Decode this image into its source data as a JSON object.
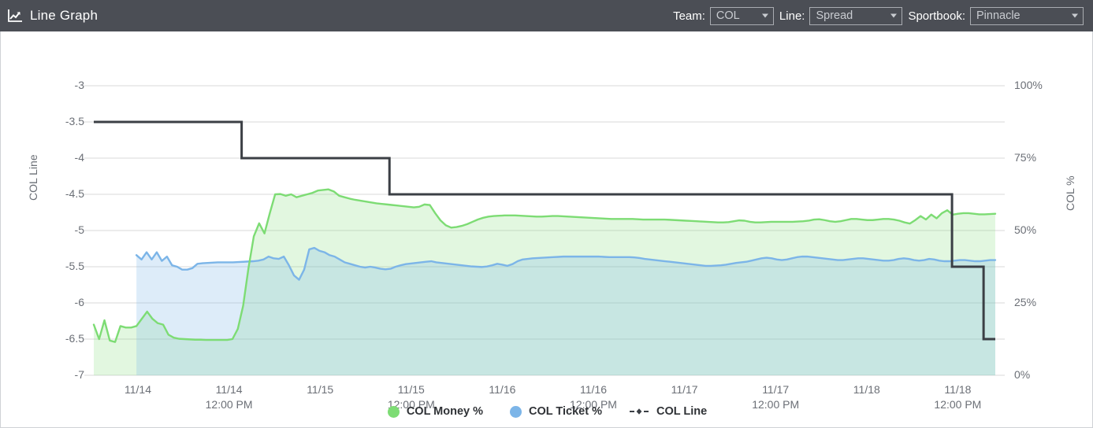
{
  "header": {
    "title": "Line Graph",
    "icon": "line-chart-icon",
    "controls": [
      {
        "label": "Team:",
        "value": "COL",
        "name": "team"
      },
      {
        "label": "Line:",
        "value": "Spread",
        "name": "line"
      },
      {
        "label": "Sportbook:",
        "value": "Pinnacle",
        "name": "sportbook"
      }
    ]
  },
  "colors": {
    "header_bg": "#4b4e55",
    "money_green": "#7ddc74",
    "ticket_blue": "#7cb5e8",
    "col_line_dark": "#3b3f45",
    "grid": "#ececec",
    "axis_text": "#6b6f76"
  },
  "legend": [
    {
      "label": "COL Money %",
      "marker": "circle",
      "color": "#7ddc74"
    },
    {
      "label": "COL Ticket %",
      "marker": "circle",
      "color": "#7cb5e8"
    },
    {
      "label": "COL Line",
      "marker": "dash-diamond",
      "color": "#3b3f45"
    }
  ],
  "chart_data": {
    "type": "line",
    "title": "Line Graph",
    "xlabel": "",
    "grid": true,
    "legend_position": "bottom",
    "axes": {
      "left": {
        "label": "COL Line",
        "ticks": [
          "-3",
          "-3.5",
          "-4",
          "-4.5",
          "-5",
          "-5.5",
          "-6",
          "-6.5",
          "-7"
        ],
        "min": -7,
        "max": -3
      },
      "right": {
        "label": "COL %",
        "ticks": [
          "100%",
          "75%",
          "50%",
          "25%",
          "0%"
        ],
        "min": 0,
        "max": 100
      }
    },
    "x_ticks": [
      {
        "date": "11/14",
        "time": ""
      },
      {
        "date": "11/14",
        "time": "12:00 PM"
      },
      {
        "date": "11/15",
        "time": ""
      },
      {
        "date": "11/15",
        "time": "12:00 PM"
      },
      {
        "date": "11/16",
        "time": ""
      },
      {
        "date": "11/16",
        "time": "12:00 PM"
      },
      {
        "date": "11/17",
        "time": ""
      },
      {
        "date": "11/17",
        "time": "12:00 PM"
      },
      {
        "date": "11/18",
        "time": ""
      },
      {
        "date": "11/18",
        "time": "12:00 PM"
      }
    ],
    "series": [
      {
        "name": "COL Money %",
        "axis": "right",
        "type": "area",
        "color": "#7ddc74",
        "values": [
          17.5,
          12.5,
          19.0,
          12.0,
          11.5,
          17.0,
          16.5,
          16.5,
          17.0,
          19.5,
          22.0,
          19.5,
          18.0,
          17.5,
          14.0,
          13.0,
          12.6,
          12.5,
          12.4,
          12.3,
          12.3,
          12.2,
          12.2,
          12.2,
          12.2,
          12.2,
          12.5,
          16.0,
          24.0,
          37.0,
          48.0,
          52.5,
          49.0,
          56.0,
          62.5,
          62.6,
          62.0,
          62.5,
          61.5,
          62.0,
          62.5,
          63.0,
          63.8,
          64.0,
          64.2,
          63.5,
          62.0,
          61.5,
          61.0,
          60.6,
          60.3,
          60.0,
          59.7,
          59.4,
          59.2,
          59.0,
          58.8,
          58.6,
          58.4,
          58.2,
          58.0,
          58.2,
          59.0,
          58.8,
          56.0,
          53.5,
          51.8,
          51.0,
          51.2,
          51.6,
          52.2,
          53.0,
          53.8,
          54.4,
          54.8,
          55.0,
          55.1,
          55.2,
          55.2,
          55.2,
          55.1,
          55.0,
          54.9,
          54.8,
          54.8,
          54.9,
          55.0,
          55.0,
          54.9,
          54.8,
          54.7,
          54.6,
          54.5,
          54.4,
          54.3,
          54.2,
          54.1,
          54.0,
          54.0,
          54.0,
          54.0,
          54.0,
          53.9,
          53.8,
          53.8,
          53.8,
          53.8,
          53.8,
          53.7,
          53.6,
          53.5,
          53.4,
          53.3,
          53.2,
          53.1,
          53.0,
          52.9,
          52.8,
          52.8,
          52.9,
          53.2,
          53.5,
          53.4,
          53.0,
          52.8,
          52.8,
          52.9,
          53.0,
          53.0,
          53.0,
          53.0,
          53.0,
          53.1,
          53.2,
          53.4,
          53.8,
          53.9,
          53.6,
          53.2,
          53.0,
          53.2,
          53.6,
          54.0,
          54.0,
          53.8,
          53.6,
          53.6,
          53.8,
          54.0,
          54.0,
          53.8,
          53.4,
          52.8,
          52.4,
          53.6,
          55.0,
          53.8,
          55.5,
          54.2,
          56.0,
          57.0,
          55.5,
          55.8,
          56.0,
          56.0,
          55.8,
          55.6,
          55.6,
          55.7,
          55.8
        ]
      },
      {
        "name": "COL Ticket %",
        "axis": "right",
        "type": "area",
        "color": "#7cb5e8",
        "start_index": 8,
        "values": [
          41.5,
          40.0,
          42.5,
          40.0,
          42.5,
          39.5,
          41.0,
          38.0,
          37.5,
          36.5,
          36.5,
          37.0,
          38.5,
          38.7,
          38.8,
          38.9,
          39.0,
          39.0,
          39.0,
          39.0,
          39.1,
          39.2,
          39.3,
          39.4,
          39.6,
          40.0,
          41.0,
          40.4,
          40.2,
          41.0,
          38.0,
          34.5,
          33.0,
          36.5,
          43.5,
          44.0,
          43.0,
          42.5,
          41.5,
          41.0,
          40.0,
          39.0,
          38.5,
          38.0,
          37.5,
          37.2,
          37.5,
          37.2,
          36.8,
          36.6,
          36.8,
          37.5,
          38.0,
          38.4,
          38.6,
          38.8,
          39.0,
          39.2,
          39.4,
          39.0,
          38.8,
          38.6,
          38.4,
          38.2,
          38.0,
          37.8,
          37.6,
          37.5,
          37.4,
          37.6,
          38.0,
          38.5,
          38.2,
          37.8,
          38.4,
          39.4,
          40.0,
          40.2,
          40.4,
          40.5,
          40.6,
          40.7,
          40.8,
          40.9,
          41.0,
          41.0,
          41.0,
          41.0,
          41.0,
          41.0,
          41.0,
          41.0,
          40.9,
          40.8,
          40.8,
          40.8,
          40.8,
          40.8,
          40.7,
          40.5,
          40.2,
          40.0,
          39.8,
          39.6,
          39.4,
          39.2,
          39.0,
          38.8,
          38.6,
          38.4,
          38.2,
          38.0,
          37.8,
          37.8,
          37.9,
          38.0,
          38.2,
          38.5,
          38.8,
          39.0,
          39.2,
          39.6,
          40.0,
          40.4,
          40.6,
          40.4,
          40.0,
          39.8,
          40.0,
          40.4,
          40.8,
          41.0,
          41.0,
          40.8,
          40.6,
          40.4,
          40.2,
          40.0,
          39.8,
          39.8,
          40.0,
          40.2,
          40.4,
          40.4,
          40.2,
          40.0,
          39.8,
          39.6,
          39.6,
          39.8,
          40.2,
          40.4,
          40.2,
          39.8,
          39.6,
          39.8,
          40.2,
          40.0,
          39.6,
          39.4,
          39.4,
          39.6,
          39.8,
          39.8,
          39.6,
          39.4,
          39.4,
          39.6,
          39.8,
          39.8
        ]
      },
      {
        "name": "COL Line",
        "axis": "left",
        "type": "step",
        "color": "#3b3f45",
        "steps": [
          {
            "x_frac": 0.0,
            "value": -3.5
          },
          {
            "x_frac": 0.164,
            "value": -4.0
          },
          {
            "x_frac": 0.328,
            "value": -4.5
          },
          {
            "x_frac": 0.952,
            "value": -5.5
          },
          {
            "x_frac": 0.987,
            "value": -6.5
          },
          {
            "x_frac": 1.0,
            "value": -6.5
          }
        ]
      }
    ]
  }
}
